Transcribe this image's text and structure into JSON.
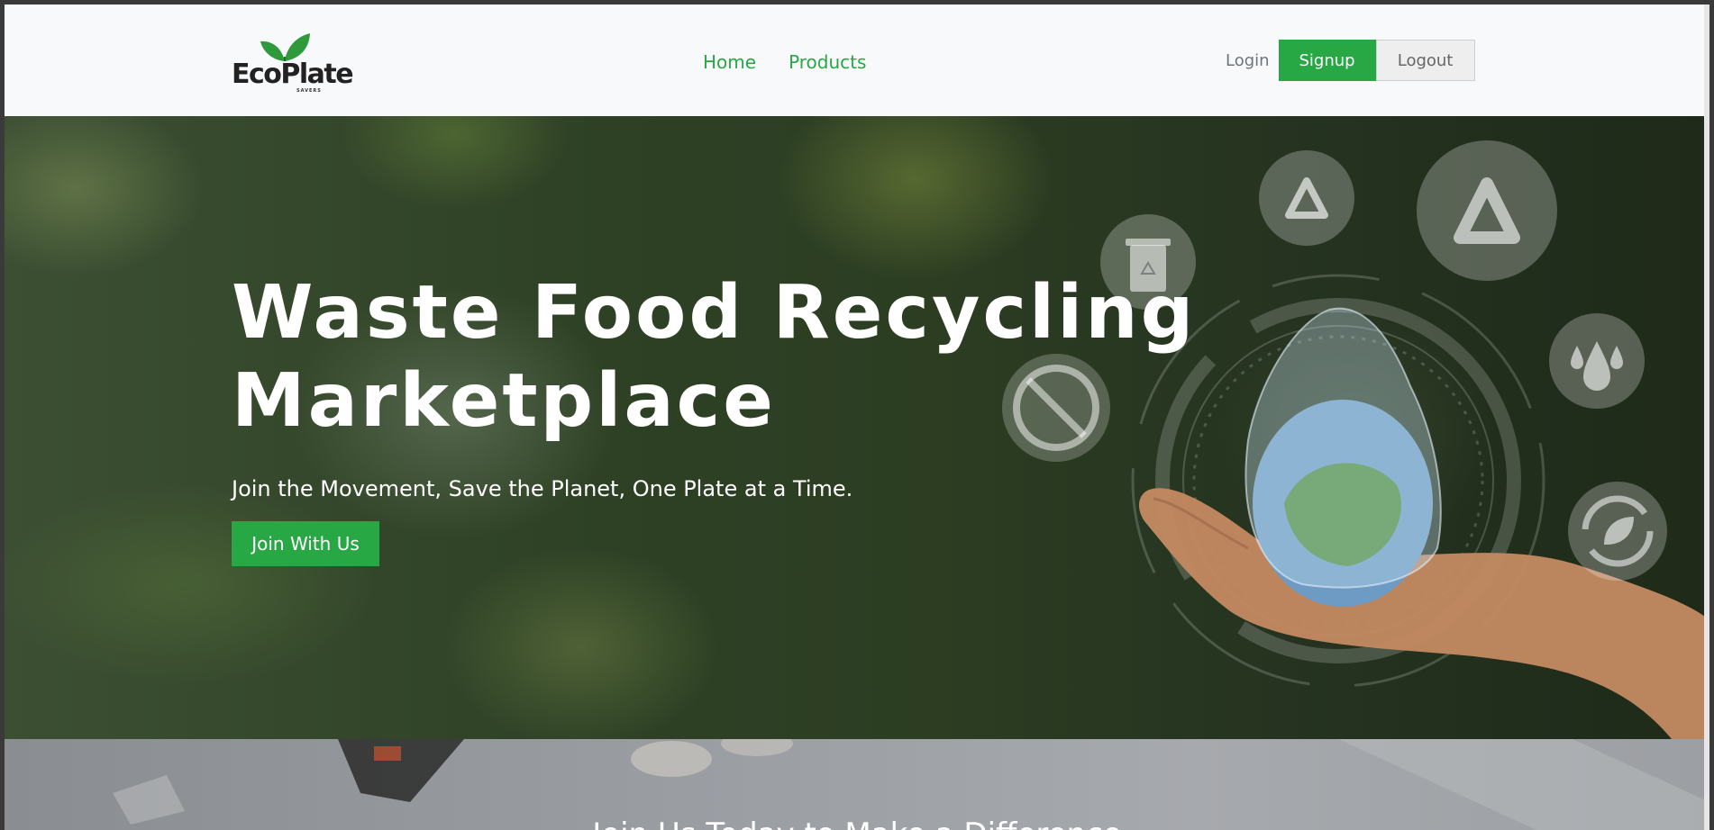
{
  "brand": {
    "name": "EcoPlate",
    "tagline": "SAVERS"
  },
  "nav": {
    "home": "Home",
    "products": "Products"
  },
  "auth": {
    "login": "Login",
    "signup": "Signup",
    "logout": "Logout"
  },
  "hero": {
    "title_line1": "Waste Food Recycling",
    "title_line2": "Marketplace",
    "subtitle": "Join the Movement, Save the Planet, One Plate at a Time.",
    "cta": "Join With Us"
  },
  "next_section": {
    "heading": "Join Us Today to Make a Difference"
  },
  "colors": {
    "accent": "#28a745",
    "header_bg": "#f8f9fa"
  },
  "icons": [
    "recycle-icon",
    "trash-bin-icon",
    "no-touch-icon",
    "water-drops-icon",
    "leaf-cycle-icon",
    "globe-in-hand-image"
  ]
}
